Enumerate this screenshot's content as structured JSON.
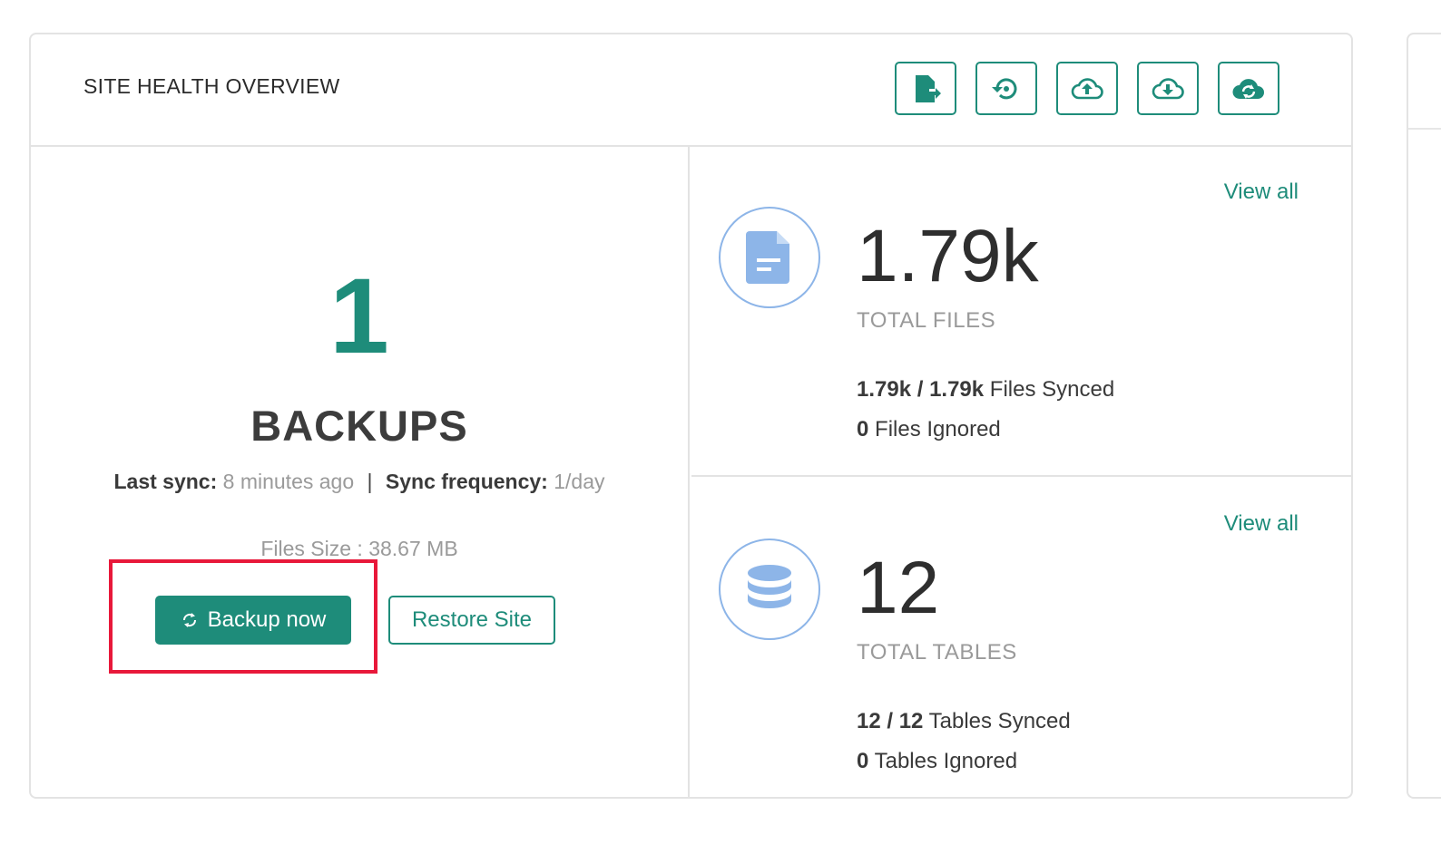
{
  "header": {
    "title": "SITE HEALTH OVERVIEW",
    "tools": [
      {
        "icon": "file-export-icon"
      },
      {
        "icon": "restore-history-icon"
      },
      {
        "icon": "cloud-upload-icon"
      },
      {
        "icon": "cloud-download-icon"
      },
      {
        "icon": "cloud-sync-icon"
      }
    ]
  },
  "backups": {
    "count": "1",
    "label": "BACKUPS",
    "last_sync_label": "Last sync:",
    "last_sync_value": "8 minutes ago",
    "separator": "|",
    "frequency_label": "Sync frequency:",
    "frequency_value": "1/day",
    "files_size": "Files Size : 38.67 MB",
    "backup_button": "Backup now",
    "restore_button": "Restore Site"
  },
  "files": {
    "view_all": "View all",
    "value": "1.79k",
    "caption": "TOTAL FILES",
    "synced_count": "1.79k / 1.79k",
    "synced_label": "Files Synced",
    "ignored_count": "0",
    "ignored_label": "Files Ignored"
  },
  "tables": {
    "view_all": "View all",
    "value": "12",
    "caption": "TOTAL TABLES",
    "synced_count": "12 / 12",
    "synced_label": "Tables Synced",
    "ignored_count": "0",
    "ignored_label": "Tables Ignored"
  },
  "colors": {
    "accent": "#1e8c7a",
    "highlight": "#e8183a",
    "icon_blue": "#8db5e8"
  }
}
